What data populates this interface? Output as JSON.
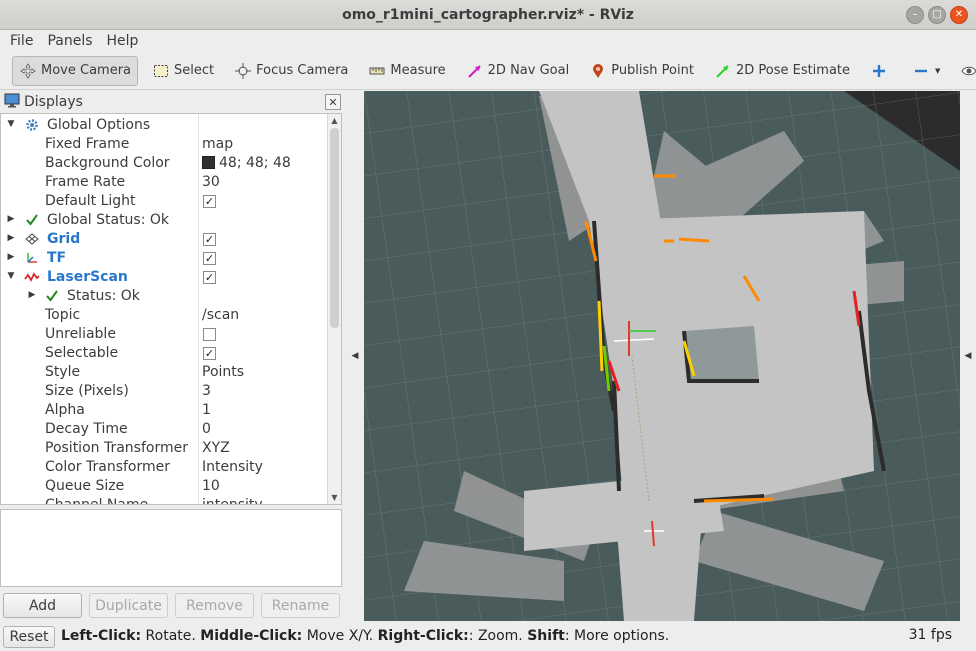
{
  "window": {
    "title": "omo_r1mini_cartographer.rviz* - RViz"
  },
  "menu": {
    "file": "File",
    "panels": "Panels",
    "help": "Help"
  },
  "toolbar": {
    "move_camera": "Move Camera",
    "select": "Select",
    "focus_camera": "Focus Camera",
    "measure": "Measure",
    "nav_goal": "2D Nav Goal",
    "publish_point": "Publish Point",
    "pose_estimate": "2D Pose Estimate"
  },
  "displays": {
    "title": "Displays",
    "rows": {
      "global_options": "Global Options",
      "fixed_frame": {
        "name": "Fixed Frame",
        "value": "map"
      },
      "background_color": {
        "name": "Background Color",
        "value": "48; 48; 48"
      },
      "frame_rate": {
        "name": "Frame Rate",
        "value": "30"
      },
      "default_light": {
        "name": "Default Light"
      },
      "global_status": "Global Status: Ok",
      "grid": "Grid",
      "tf": "TF",
      "laserscan": "LaserScan",
      "status_ok": "Status: Ok",
      "topic": {
        "name": "Topic",
        "value": "/scan"
      },
      "unreliable": {
        "name": "Unreliable"
      },
      "selectable": {
        "name": "Selectable"
      },
      "style": {
        "name": "Style",
        "value": "Points"
      },
      "size": {
        "name": "Size (Pixels)",
        "value": "3"
      },
      "alpha": {
        "name": "Alpha",
        "value": "1"
      },
      "decay": {
        "name": "Decay Time",
        "value": "0"
      },
      "position_transformer": {
        "name": "Position Transformer",
        "value": "XYZ"
      },
      "color_transformer": {
        "name": "Color Transformer",
        "value": "Intensity"
      },
      "queue_size": {
        "name": "Queue Size",
        "value": "10"
      },
      "channel_name": {
        "name": "Channel Name",
        "value": "intensity"
      }
    },
    "buttons": {
      "add": "Add",
      "duplicate": "Duplicate",
      "remove": "Remove",
      "rename": "Rename"
    }
  },
  "statusbar": {
    "reset": "Reset",
    "hint_left_key": "Left-Click:",
    "hint_left": " Rotate. ",
    "hint_middle_key": "Middle-Click:",
    "hint_middle": " Move X/Y. ",
    "hint_right_key": "Right-Click:",
    "hint_right": ": Zoom. ",
    "hint_shift_key": "Shift",
    "hint_shift": ": More options.",
    "fps": "31 fps"
  },
  "colors": {
    "accent_blue": "#2a77c9",
    "viewport_bg": "#4a5b5b",
    "map_free": "#b8b8b8",
    "close_button": "#e95420"
  }
}
